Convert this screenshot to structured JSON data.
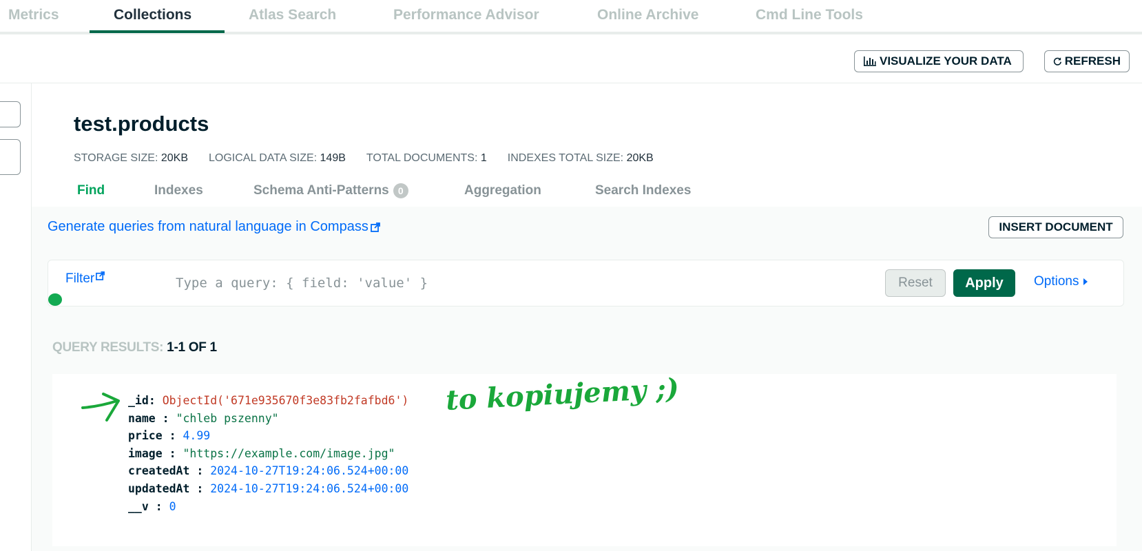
{
  "top_tabs": [
    {
      "label": "Metrics"
    },
    {
      "label": "Collections"
    },
    {
      "label": "Atlas Search"
    },
    {
      "label": "Performance Advisor"
    },
    {
      "label": "Online Archive"
    },
    {
      "label": "Cmd Line Tools"
    }
  ],
  "header_buttons": {
    "visualize": "VISUALIZE YOUR DATA",
    "refresh": "REFRESH"
  },
  "namespace": {
    "title": "test.products",
    "stats": [
      {
        "label": "STORAGE SIZE:",
        "value": "20KB"
      },
      {
        "label": "LOGICAL DATA SIZE:",
        "value": "149B"
      },
      {
        "label": "TOTAL DOCUMENTS:",
        "value": "1"
      },
      {
        "label": "INDEXES TOTAL SIZE:",
        "value": "20KB"
      }
    ]
  },
  "sub_tabs": [
    {
      "label": "Find"
    },
    {
      "label": "Indexes"
    },
    {
      "label": "Schema Anti-Patterns",
      "badge": "0"
    },
    {
      "label": "Aggregation"
    },
    {
      "label": "Search Indexes"
    }
  ],
  "nl_query_link": "Generate queries from natural language in Compass",
  "insert_document": "INSERT DOCUMENT",
  "filter": {
    "label": "Filter",
    "placeholder": "Type a query: { field: 'value' }",
    "reset": "Reset",
    "apply": "Apply",
    "options": "Options"
  },
  "results": {
    "label": "QUERY RESULTS:",
    "range": "1-1 OF 1"
  },
  "document": {
    "fields": [
      {
        "key": "_id",
        "sep": ": ",
        "value": "ObjectId('671e935670f3e83fb2fafbd6')",
        "type": "oid"
      },
      {
        "key": "name",
        "sep": " : ",
        "value": "\"chleb pszenny\"",
        "type": "str"
      },
      {
        "key": "price",
        "sep": " : ",
        "value": "4.99",
        "type": "num"
      },
      {
        "key": "image",
        "sep": " : ",
        "value": "\"https://example.com/image.jpg\"",
        "type": "str"
      },
      {
        "key": "createdAt",
        "sep": " : ",
        "value": "2024-10-27T19:24:06.524+00:00",
        "type": "date"
      },
      {
        "key": "updatedAt",
        "sep": " : ",
        "value": "2024-10-27T19:24:06.524+00:00",
        "type": "date"
      },
      {
        "key": "__v",
        "sep": " : ",
        "value": "0",
        "type": "num"
      }
    ]
  },
  "annotation": {
    "text": "to kopiujemy ;)",
    "color": "#1aa83a"
  },
  "colors": {
    "accent_green": "#00684a",
    "link_blue": "#016bf8",
    "active_tab_green": "#00a35c"
  }
}
